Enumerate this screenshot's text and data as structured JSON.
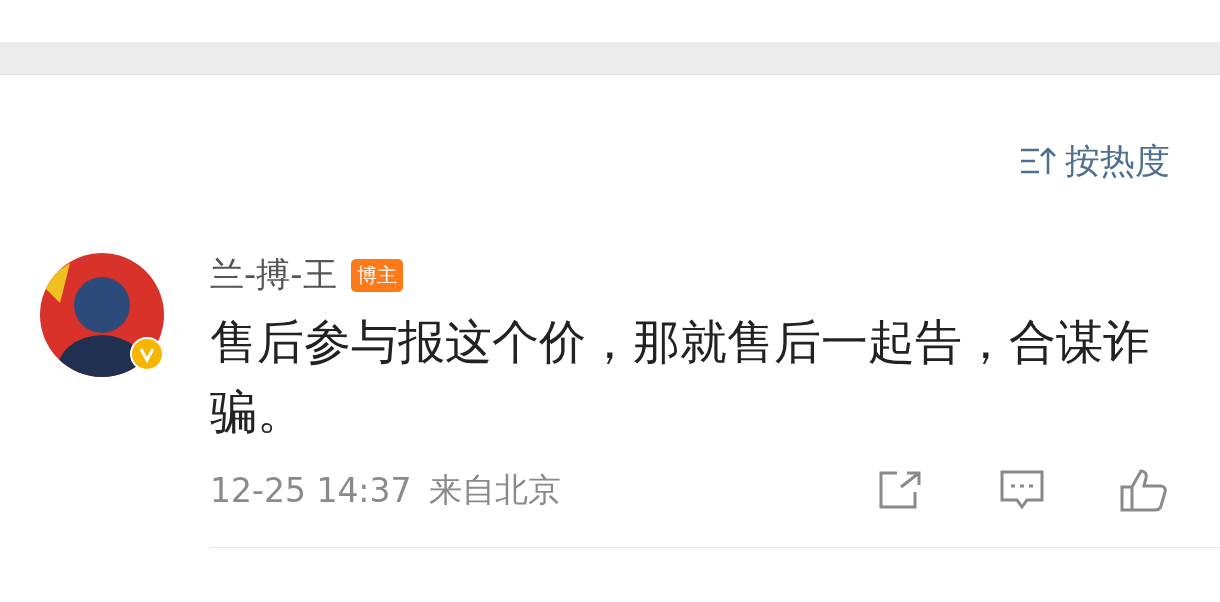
{
  "sort": {
    "label": "按热度"
  },
  "comments": [
    {
      "username": "兰-搏-王",
      "badge": "博主",
      "verified": true,
      "text": "售后参与报这个价，那就售后一起告，合谋诈骗。",
      "time": "12-25 14:37",
      "location": "来自北京"
    }
  ]
}
